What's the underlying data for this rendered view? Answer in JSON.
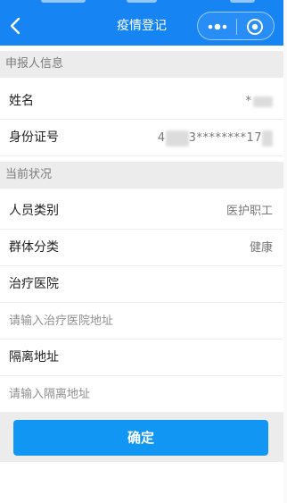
{
  "header": {
    "title": "疫情登记",
    "background_color": "#1684f3",
    "back_icon": "chevron-left-icon",
    "more_icon": "more-dots-icon",
    "close_icon": "target-circle-icon"
  },
  "sections": {
    "applicant": {
      "title": "申报人信息"
    },
    "status": {
      "title": "当前状况"
    }
  },
  "fields": {
    "name": {
      "label": "姓名",
      "value": "*"
    },
    "id_number": {
      "label": "身份证号",
      "value_prefix": "4",
      "value_middle": "3********17"
    },
    "person_type": {
      "label": "人员类别",
      "value": "医护职工"
    },
    "group_class": {
      "label": "群体分类",
      "value": "健康"
    },
    "hospital": {
      "label": "治疗医院",
      "placeholder": "请输入治疗医院地址"
    },
    "isolation": {
      "label": "隔离地址",
      "placeholder": "请输入隔离地址"
    }
  },
  "confirm": {
    "label": "确定",
    "color": "#1296f4"
  }
}
